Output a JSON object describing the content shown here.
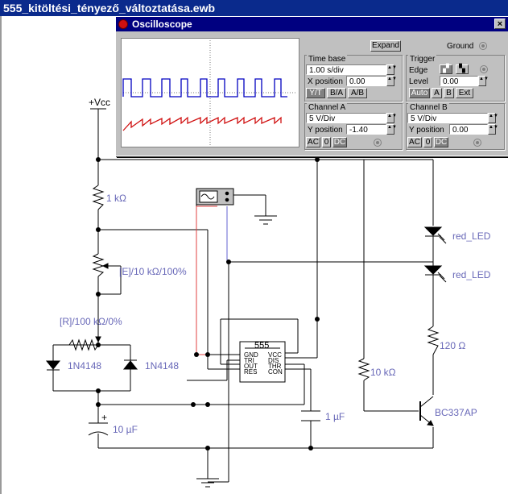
{
  "window": {
    "title": "555_kitöltési_tényező_változtatása.ewb"
  },
  "oscilloscope": {
    "title": "Oscilloscope",
    "close_glyph": "×",
    "expand_label": "Expand",
    "ground_label": "Ground",
    "timebase": {
      "title": "Time base",
      "value": "1.00 s/div",
      "xpos_label": "X position",
      "xpos_value": "0.00",
      "modes": [
        "Y/T",
        "B/A",
        "A/B"
      ]
    },
    "trigger": {
      "title": "Trigger",
      "edge_label": "Edge",
      "level_label": "Level",
      "level_value": "0.00",
      "sources": [
        "Auto",
        "A",
        "B",
        "Ext"
      ]
    },
    "channel_a": {
      "title": "Channel A",
      "value": "5 V/Div",
      "ypos_label": "Y position",
      "ypos_value": "-1.40",
      "coupling": [
        "AC",
        "0",
        "DC"
      ]
    },
    "channel_b": {
      "title": "Channel B",
      "value": "5 V/Div",
      "ypos_label": "Y position",
      "ypos_value": "0.00",
      "coupling": [
        "AC",
        "0",
        "DC"
      ]
    },
    "trace_colors": {
      "channel_a": "#0000c0",
      "channel_b": "#d01010"
    }
  },
  "schematic": {
    "vcc": "+Vcc",
    "r1": "1 kΩ",
    "pot_e": "[E]/10 kΩ/100%",
    "pot_r": "[R]/100 kΩ/0%",
    "d1": "1N4148",
    "d2": "1N4148",
    "c1": "10 µF",
    "c1_plus": "+",
    "c2": "1 µF",
    "r2": "10 kΩ",
    "r3": "120 Ω",
    "led1": "red_LED",
    "led2": "red_LED",
    "transistor": "BC337AP",
    "ic": {
      "name": "555",
      "left_pins": [
        "GND",
        "TRI",
        "OUT",
        "RES"
      ],
      "right_pins": [
        "VCC",
        "DIS",
        "THR",
        "CON"
      ]
    },
    "wire_colors": {
      "channel_a": "#6060d0",
      "channel_b": "#e04040"
    }
  }
}
